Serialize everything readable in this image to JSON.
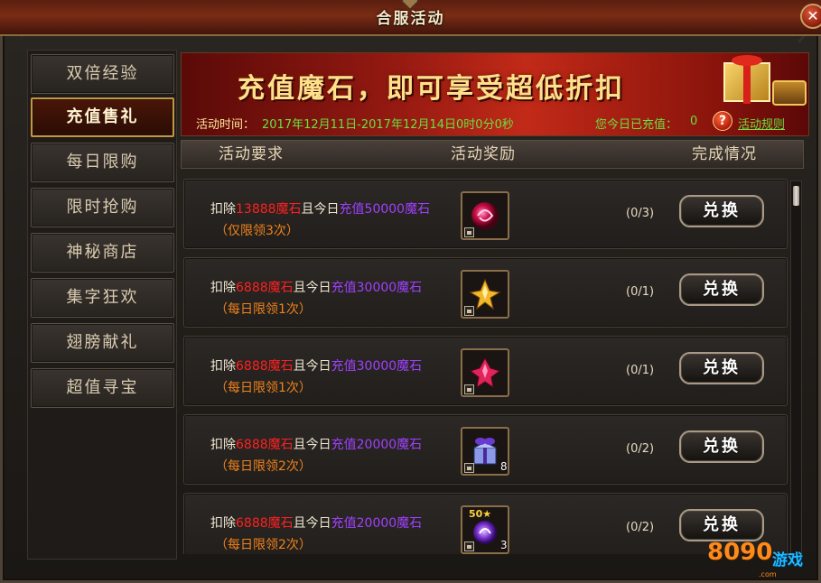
{
  "window": {
    "title": "合服活动",
    "close_label": "✕"
  },
  "sidebar": {
    "items": [
      {
        "label": "双倍经验",
        "active": false
      },
      {
        "label": "充值售礼",
        "active": true
      },
      {
        "label": "每日限购",
        "active": false
      },
      {
        "label": "限时抢购",
        "active": false
      },
      {
        "label": "神秘商店",
        "active": false
      },
      {
        "label": "集字狂欢",
        "active": false
      },
      {
        "label": "翅膀献礼",
        "active": false
      },
      {
        "label": "超值寻宝",
        "active": false
      }
    ]
  },
  "banner": {
    "slogan": "充值魔石，即可享受超低折扣",
    "time_label": "活动时间：",
    "time_value": "2017年12月11日-2017年12月14日0时0分0秒",
    "recharge_label": "您今日已充值：",
    "recharge_value": "0",
    "help_icon": "question-icon",
    "help_glyph": "?",
    "rules_label": "活动规则"
  },
  "table": {
    "headers": {
      "requirement": "活动要求",
      "reward": "活动奖励",
      "status": "完成情况"
    },
    "rows": [
      {
        "deduct_prefix": "扣除",
        "deduct_value": "13888魔石",
        "middle": "且今日",
        "charge": "充值50000魔石",
        "limit": "（仅限领3次）",
        "item_icon": "red-orb-icon",
        "item_count": "",
        "item_badge": "",
        "progress": "(0/3)",
        "button": "兑换"
      },
      {
        "deduct_prefix": "扣除",
        "deduct_value": "6888魔石",
        "middle": "且今日",
        "charge": "充值30000魔石",
        "limit": "（每日限领1次）",
        "item_icon": "gold-crystal-icon",
        "item_count": "",
        "item_badge": "",
        "progress": "(0/1)",
        "button": "兑换"
      },
      {
        "deduct_prefix": "扣除",
        "deduct_value": "6888魔石",
        "middle": "且今日",
        "charge": "充值30000魔石",
        "limit": "（每日限领1次）",
        "item_icon": "pink-crystal-icon",
        "item_count": "",
        "item_badge": "",
        "progress": "(0/1)",
        "button": "兑换"
      },
      {
        "deduct_prefix": "扣除",
        "deduct_value": "6888魔石",
        "middle": "且今日",
        "charge": "充值20000魔石",
        "limit": "（每日限领2次）",
        "item_icon": "gift-box-icon",
        "item_count": "8",
        "item_badge": "",
        "progress": "(0/2)",
        "button": "兑换"
      },
      {
        "deduct_prefix": "扣除",
        "deduct_value": "6888魔石",
        "middle": "且今日",
        "charge": "充值20000魔石",
        "limit": "（每日限领2次）",
        "item_icon": "purple-soul-icon",
        "item_count": "3",
        "item_badge": "50★",
        "progress": "(0/2)",
        "button": "兑换"
      }
    ]
  },
  "watermark": {
    "number": "8090",
    "text": "游戏",
    "domain": ".com"
  },
  "colors": {
    "deduct": "#ff2020",
    "charge": "#a040ff",
    "limit": "#f0821c",
    "time": "#6ae040",
    "slogan": "#ffe08a"
  }
}
